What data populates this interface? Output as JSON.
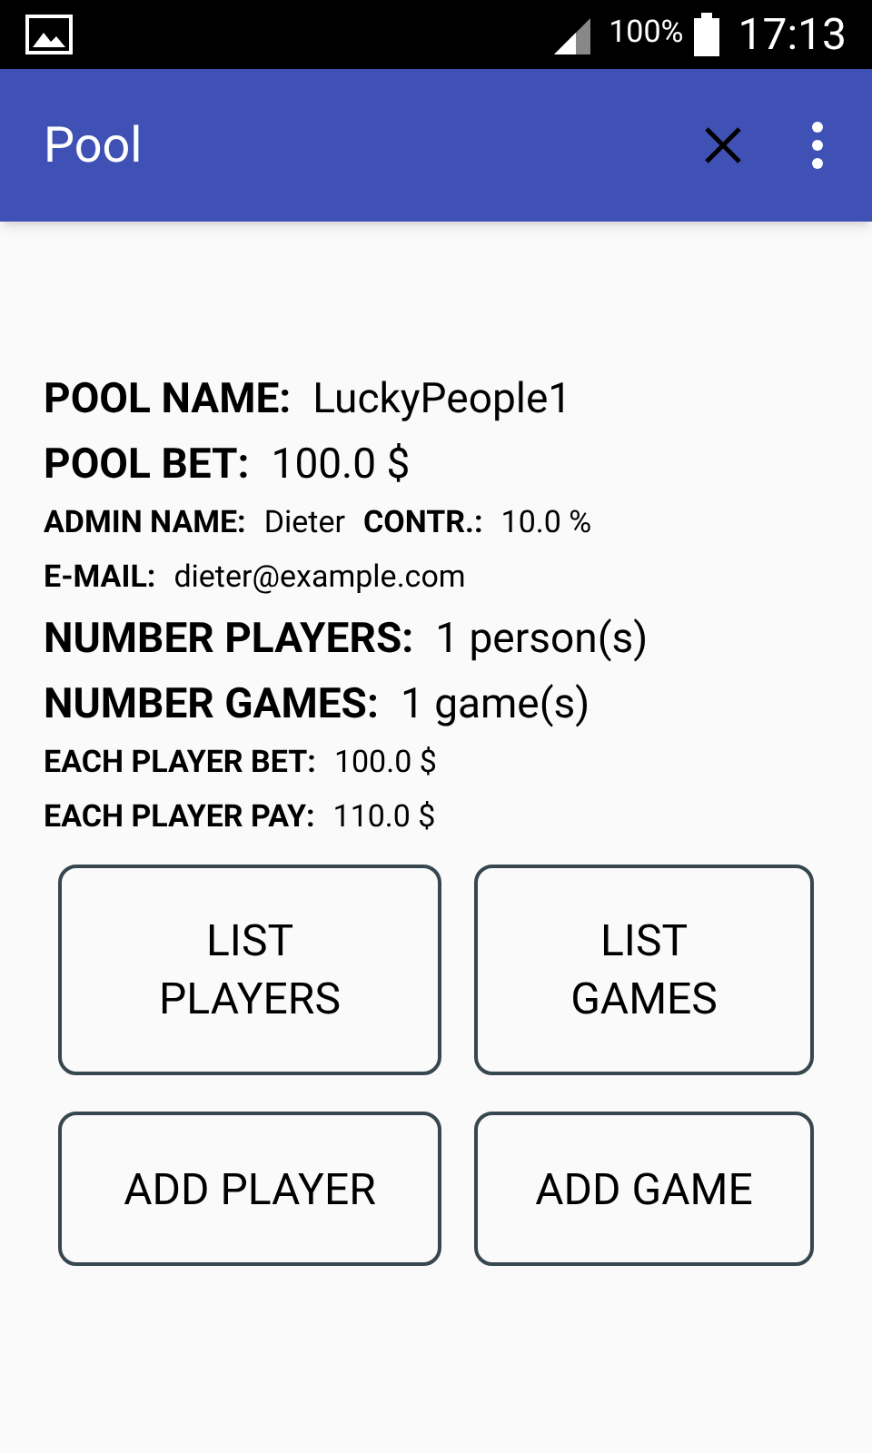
{
  "status_bar": {
    "battery": "100%",
    "time": "17:13"
  },
  "app_bar": {
    "title": "Pool"
  },
  "info_rows": [
    {
      "kind": "large",
      "pairs": [
        {
          "label": "POOL NAME:",
          "value": "LuckyPeople1"
        }
      ]
    },
    {
      "kind": "large",
      "pairs": [
        {
          "label": "POOL BET:",
          "value": "100.0 $"
        }
      ]
    },
    {
      "kind": "small",
      "pairs": [
        {
          "label": "ADMIN NAME:",
          "value": "Dieter"
        },
        {
          "label": "CONTR.:",
          "value": "10.0 %"
        }
      ]
    },
    {
      "kind": "small",
      "pairs": [
        {
          "label": "E-MAIL:",
          "value": "dieter@example.com"
        }
      ]
    },
    {
      "kind": "large",
      "pairs": [
        {
          "label": "NUMBER PLAYERS:",
          "value": "1 person(s)"
        }
      ]
    },
    {
      "kind": "large",
      "pairs": [
        {
          "label": "NUMBER GAMES:",
          "value": "1 game(s)"
        }
      ]
    },
    {
      "kind": "small",
      "pairs": [
        {
          "label": "EACH PLAYER BET:",
          "value": "100.0 $"
        }
      ]
    },
    {
      "kind": "small",
      "pairs": [
        {
          "label": "EACH PLAYER PAY:",
          "value": "110.0 $"
        }
      ]
    }
  ],
  "buttons": [
    {
      "lines": [
        "LIST",
        "PLAYERS"
      ]
    },
    {
      "lines": [
        "LIST",
        "GAMES"
      ]
    },
    {
      "lines": [
        "ADD PLAYER"
      ]
    },
    {
      "lines": [
        "ADD GAME"
      ]
    }
  ]
}
